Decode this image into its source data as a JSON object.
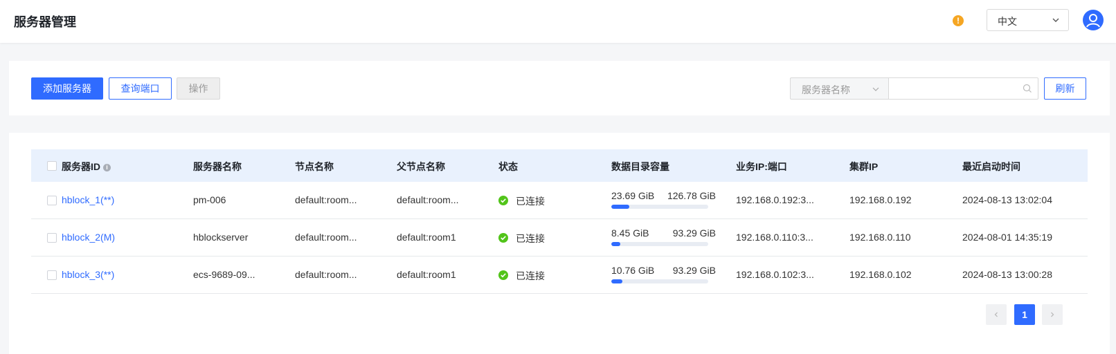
{
  "header": {
    "title": "服务器管理",
    "language": "中文",
    "alert_icon": "exclamation-icon",
    "avatar_icon": "user-icon"
  },
  "toolbar": {
    "add_label": "添加服务器",
    "query_ports_label": "查询端口",
    "operate_label": "操作",
    "search_field": "服务器名称",
    "search_value": "",
    "refresh_label": "刷新"
  },
  "table": {
    "columns": [
      "服务器ID",
      "服务器名称",
      "节点名称",
      "父节点名称",
      "状态",
      "数据目录容量",
      "业务IP:端口",
      "集群IP",
      "最近启动时间"
    ],
    "rows": [
      {
        "id": "hblock_1(**)",
        "name": "pm-006",
        "node": "default:room...",
        "parent": "default:room...",
        "status": "已连接",
        "cap_used": "23.69 GiB",
        "cap_total": "126.78 GiB",
        "cap_ratio": 0.187,
        "ip_port": "192.168.0.192:3...",
        "cluster_ip": "192.168.0.192",
        "start_time": "2024-08-13 13:02:04"
      },
      {
        "id": "hblock_2(M)",
        "name": "hblockserver",
        "node": "default:room...",
        "parent": "default:room1",
        "status": "已连接",
        "cap_used": "8.45 GiB",
        "cap_total": "93.29 GiB",
        "cap_ratio": 0.091,
        "ip_port": "192.168.0.110:3...",
        "cluster_ip": "192.168.0.110",
        "start_time": "2024-08-01 14:35:19"
      },
      {
        "id": "hblock_3(**)",
        "name": "ecs-9689-09...",
        "node": "default:room...",
        "parent": "default:room1",
        "status": "已连接",
        "cap_used": "10.76 GiB",
        "cap_total": "93.29 GiB",
        "cap_ratio": 0.115,
        "ip_port": "192.168.0.102:3...",
        "cluster_ip": "192.168.0.102",
        "start_time": "2024-08-13 13:00:28"
      }
    ]
  },
  "pagination": {
    "current_page": "1",
    "prev_icon": "chevron-left-icon",
    "next_icon": "chevron-right-icon"
  },
  "colors": {
    "primary": "#2f6bff",
    "success": "#52c41a",
    "warning": "#f5a623",
    "header_row": "#e9f1fd"
  }
}
